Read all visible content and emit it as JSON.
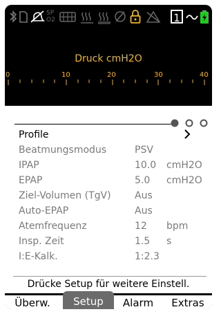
{
  "status_bar": {
    "icons": [
      "bluetooth-icon",
      "sd-card-icon",
      "alarm-mute-icon",
      "spo2-icon",
      "battery-pack-icon",
      "humidifier-icon",
      "heater-icon",
      "no-time-icon",
      "lock-icon",
      "alarm-off-icon",
      "profile-number-icon",
      "waveform-icon",
      "battery-charging-icon"
    ],
    "sp_label": "SP",
    "o2_label": "O2",
    "profile_number": "1"
  },
  "gauge": {
    "label": "Druck cmH2O",
    "ticks": [
      "0",
      "10",
      "20",
      "30",
      "40"
    ]
  },
  "page_indicator": {
    "pages": 3,
    "active": 1
  },
  "profile": {
    "label": "Profile"
  },
  "settings": [
    {
      "name": "Beatmungsmodus",
      "value": "PSV",
      "unit": ""
    },
    {
      "name": "IPAP",
      "value": "10.0",
      "unit": "cmH2O"
    },
    {
      "name": "EPAP",
      "value": "5.0",
      "unit": "cmH2O"
    },
    {
      "name": "Ziel-Volumen (TgV)",
      "value": "Aus",
      "unit": ""
    },
    {
      "name": "Auto-EPAP",
      "value": "Aus",
      "unit": ""
    },
    {
      "name": "Atemfrequenz",
      "value": "12",
      "unit": "bpm"
    },
    {
      "name": "Insp. Zeit",
      "value": "1.5",
      "unit": "s"
    },
    {
      "name": "I:E-Kalk.",
      "value": "1:2.3",
      "unit": ""
    }
  ],
  "hint": "Drücke Setup für weitere Einstell.",
  "tabs": [
    {
      "label": "Überw.",
      "active": false
    },
    {
      "label": "Setup",
      "active": true
    },
    {
      "label": "Alarm",
      "active": false
    },
    {
      "label": "Extras",
      "active": false
    }
  ],
  "colors": {
    "accent": "#f5b800",
    "charging": "#22cc22",
    "active_tab": "#6b6b6b",
    "muted_text": "#7a7a7a"
  }
}
